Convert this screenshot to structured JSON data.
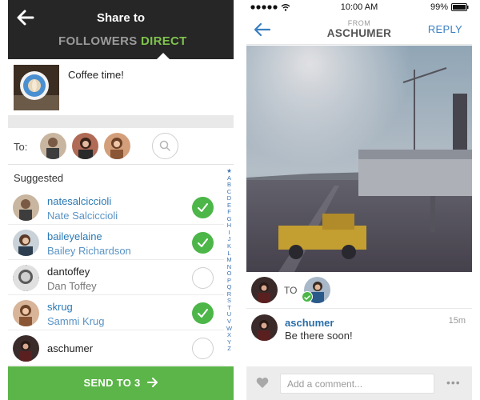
{
  "share": {
    "title": "Share to",
    "tabs": [
      "FOLLOWERS",
      "DIRECT"
    ],
    "active_tab": "DIRECT",
    "caption": "Coffee time!",
    "to_label": "To:",
    "suggested_label": "Suggested",
    "alphabet": [
      "★",
      "A",
      "B",
      "C",
      "D",
      "E",
      "F",
      "G",
      "H",
      "I",
      "J",
      "K",
      "L",
      "M",
      "N",
      "O",
      "P",
      "Q",
      "R",
      "S",
      "T",
      "U",
      "V",
      "W",
      "X",
      "Y",
      "Z"
    ],
    "users": [
      {
        "username": "natesalciccioli",
        "fullname": "Nate Salciccioli",
        "checked": true
      },
      {
        "username": "baileyelaine",
        "fullname": "Bailey Richardson",
        "checked": true
      },
      {
        "username": "dantoffey",
        "fullname": "Dan Toffey",
        "checked": false
      },
      {
        "username": "skrug",
        "fullname": "Sammi Krug",
        "checked": true
      },
      {
        "username": "aschumer",
        "fullname": "",
        "checked": false
      }
    ],
    "send_label": "SEND TO 3"
  },
  "direct": {
    "status_time": "10:00 AM",
    "status_battery": "99%",
    "from_label": "FROM",
    "from_user": "ASCHUMER",
    "reply_label": "REPLY",
    "to_label": "TO",
    "comment_user": "aschumer",
    "comment_text": "Be there soon!",
    "comment_time": "15m",
    "comment_placeholder": "Add a comment...",
    "more_label": "•••"
  },
  "colors": {
    "header_dark": "#262626",
    "accent_green": "#7fc34c",
    "check_green": "#4cb648",
    "send_green": "#5cb548",
    "link_blue": "#2a7ab5"
  }
}
